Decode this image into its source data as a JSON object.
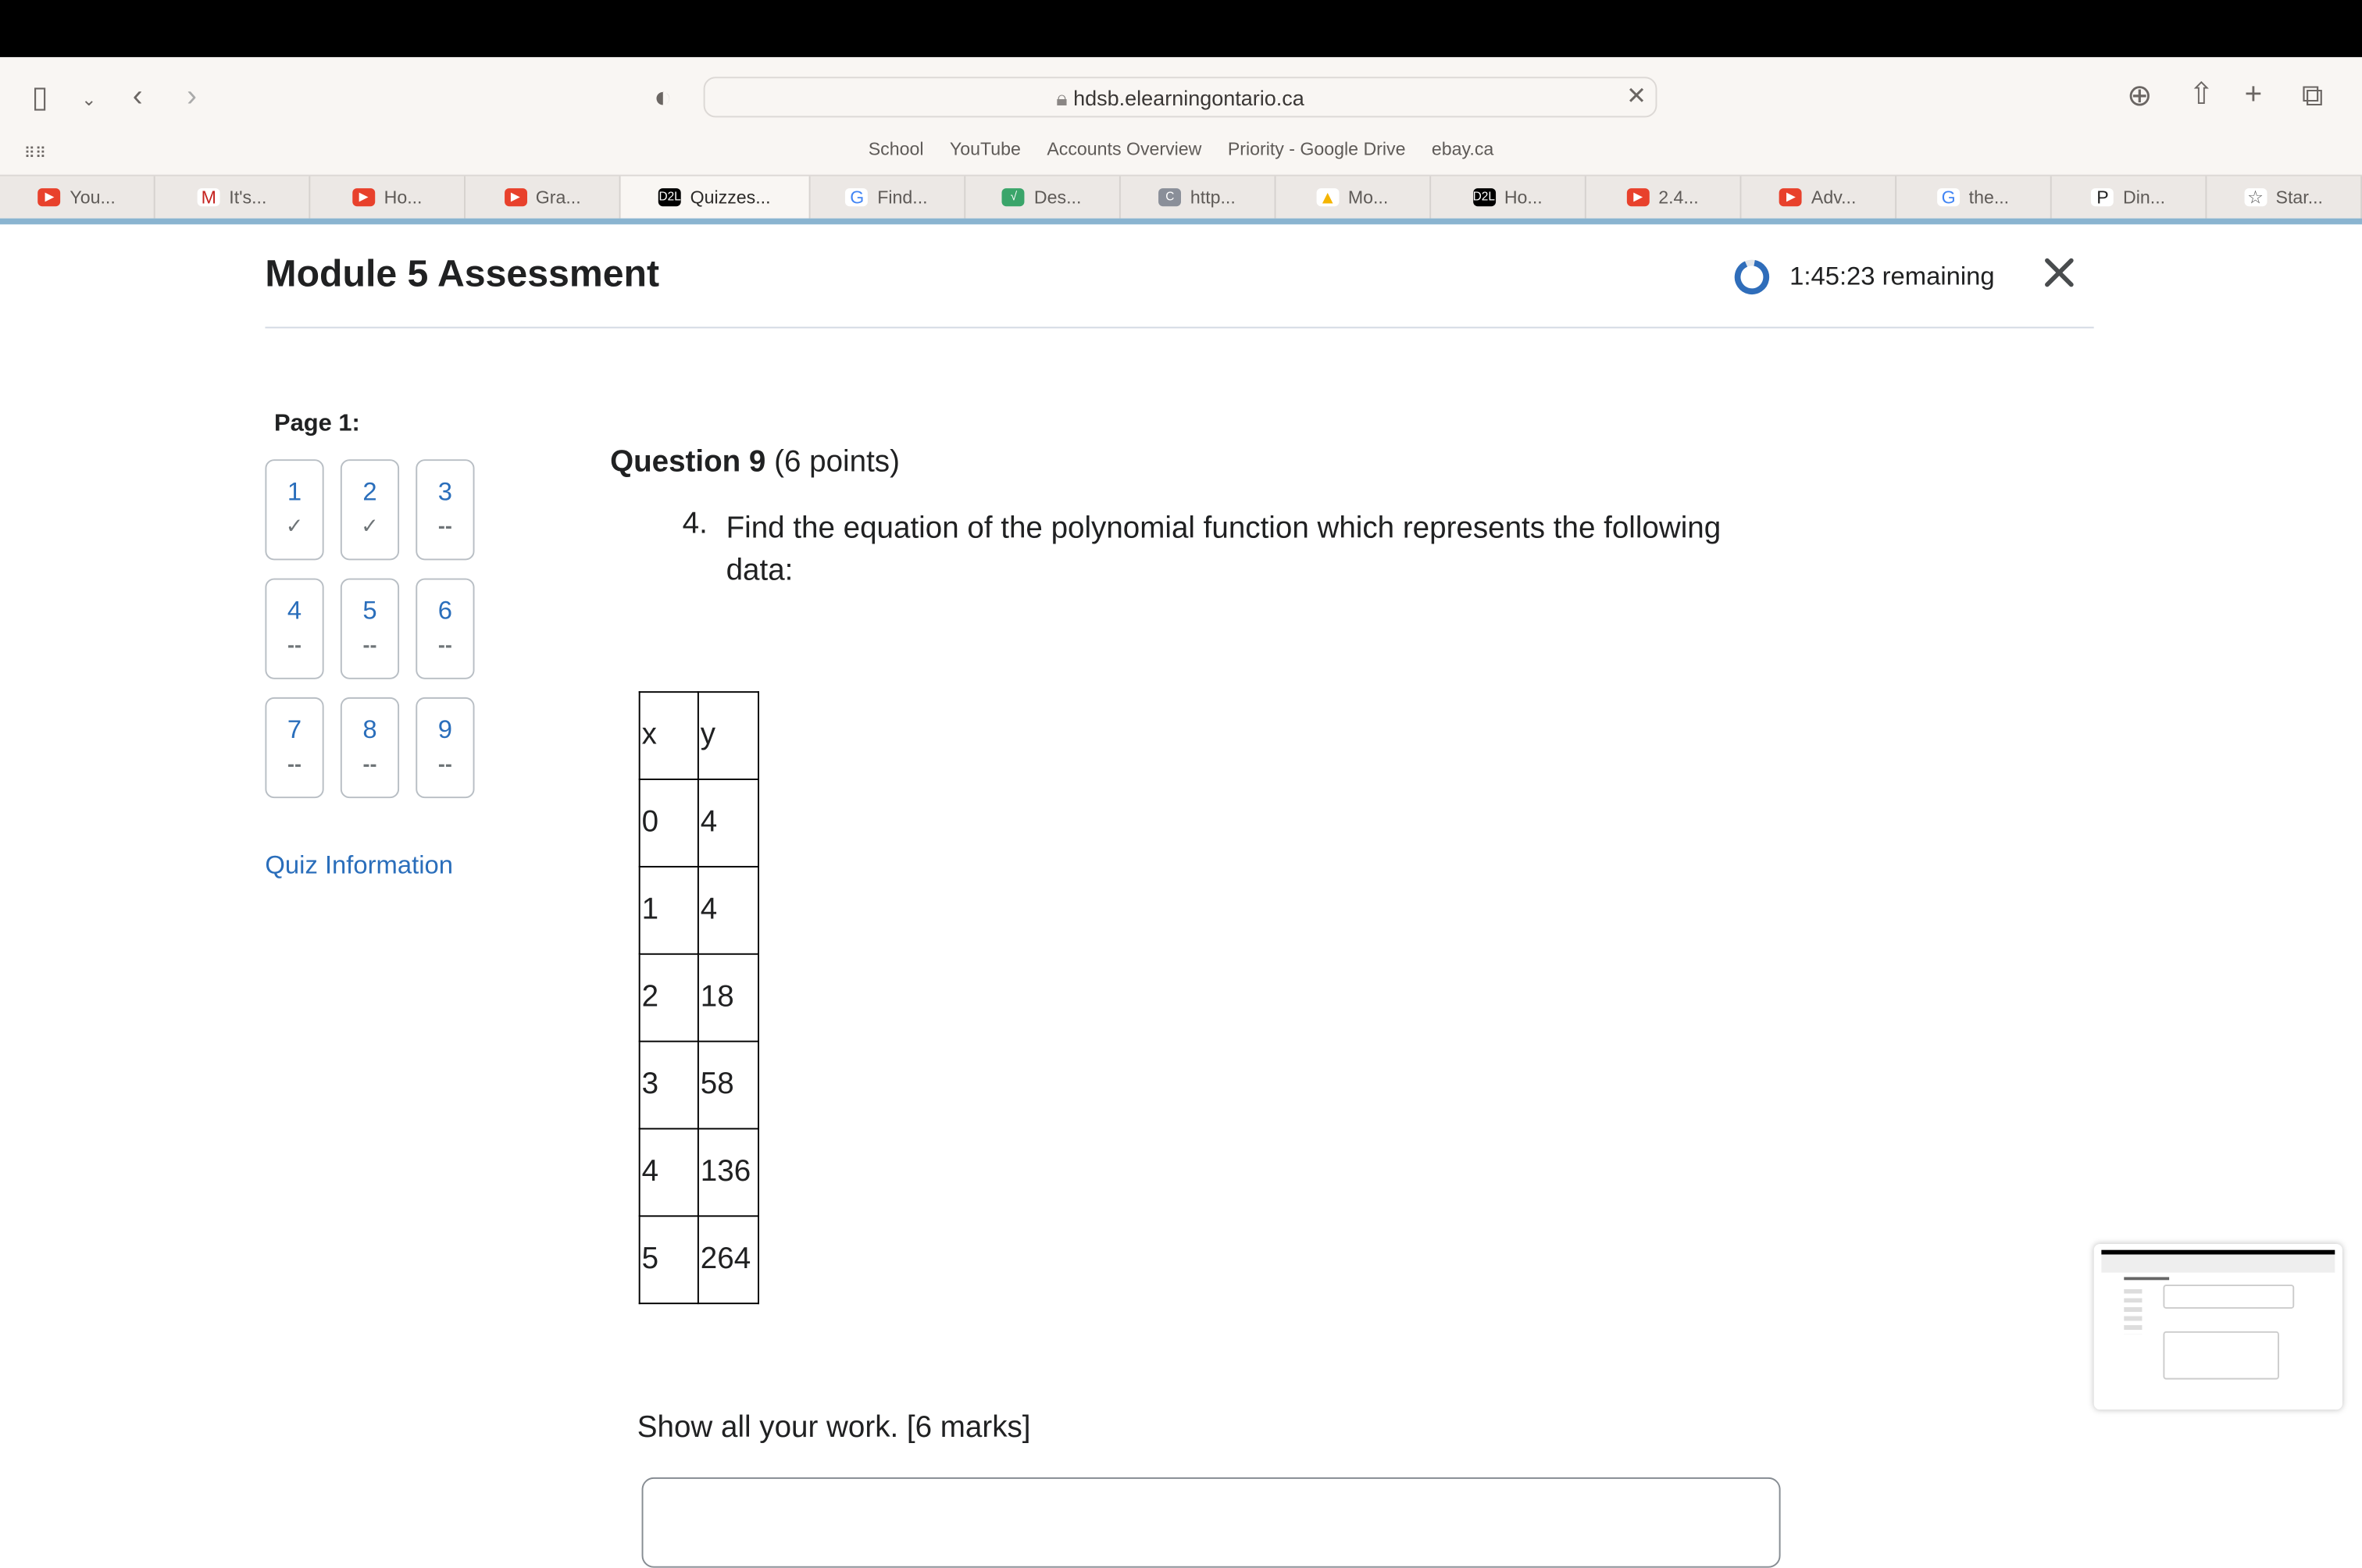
{
  "browser": {
    "url": "hdsb.elearningontario.ca",
    "bookmarks": [
      "School",
      "YouTube",
      "Accounts Overview",
      "Priority - Google Drive",
      "ebay.ca"
    ],
    "tabs": [
      {
        "label": "You...",
        "icon": "youtube-icon"
      },
      {
        "label": "It's...",
        "icon": "gmail-icon"
      },
      {
        "label": "Ho...",
        "icon": "youtube-icon"
      },
      {
        "label": "Gra...",
        "icon": "youtube-icon"
      },
      {
        "label": "Quizzes...",
        "icon": "d2l-icon",
        "active": true
      },
      {
        "label": "Find...",
        "icon": "google-icon"
      },
      {
        "label": "Des...",
        "icon": "desmos-icon"
      },
      {
        "label": "http...",
        "icon": "c-icon"
      },
      {
        "label": "Mo...",
        "icon": "google-drive-icon"
      },
      {
        "label": "Ho...",
        "icon": "d2l-icon"
      },
      {
        "label": "2.4...",
        "icon": "youtube-icon"
      },
      {
        "label": "Adv...",
        "icon": "youtube-icon"
      },
      {
        "label": "the...",
        "icon": "google-icon"
      },
      {
        "label": "Din...",
        "icon": "p-icon"
      },
      {
        "label": "Star...",
        "icon": "star-icon"
      }
    ]
  },
  "header": {
    "title": "Module 5 Assessment",
    "timer": "1:45:23 remaining",
    "accent": "#2a6ebb"
  },
  "nav": {
    "page_label": "Page 1:",
    "questions": [
      {
        "num": "1",
        "status": "✓"
      },
      {
        "num": "2",
        "status": "✓"
      },
      {
        "num": "3",
        "status": "--"
      },
      {
        "num": "4",
        "status": "--"
      },
      {
        "num": "5",
        "status": "--"
      },
      {
        "num": "6",
        "status": "--"
      },
      {
        "num": "7",
        "status": "--"
      },
      {
        "num": "8",
        "status": "--"
      },
      {
        "num": "9",
        "status": "--"
      }
    ],
    "quiz_info": "Quiz Information"
  },
  "question": {
    "title": "Question 9",
    "points": "(6 points)",
    "number": "4.",
    "text": "Find the equation of the polynomial function which represents the following data:",
    "table": {
      "headers": [
        "x",
        "y"
      ],
      "rows": [
        [
          "0",
          "4"
        ],
        [
          "1",
          "4"
        ],
        [
          "2",
          "18"
        ],
        [
          "3",
          "58"
        ],
        [
          "4",
          "136"
        ],
        [
          "5",
          "264"
        ]
      ]
    },
    "instruction": "Show all your work. [6 marks]"
  }
}
